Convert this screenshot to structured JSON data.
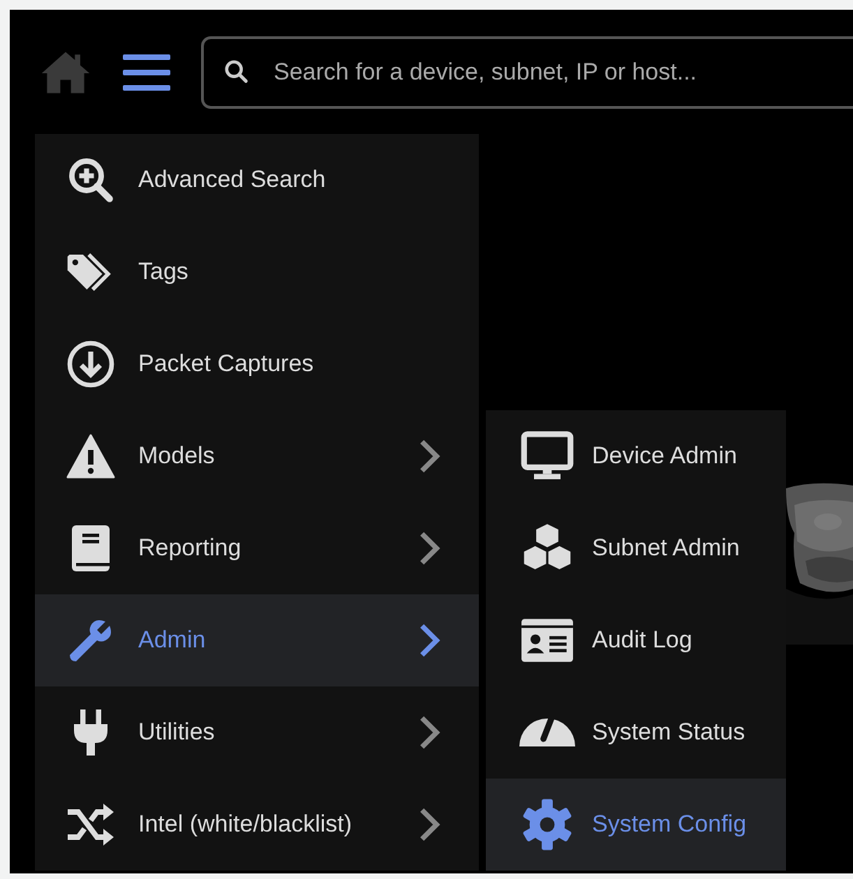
{
  "header": {
    "search": {
      "placeholder": "Search for a device, subnet, IP or host..."
    },
    "menu_button": {
      "active": true
    }
  },
  "menu": {
    "items": [
      {
        "label": "Advanced Search",
        "has_submenu": false,
        "selected": false
      },
      {
        "label": "Tags",
        "has_submenu": false,
        "selected": false
      },
      {
        "label": "Packet Captures",
        "has_submenu": false,
        "selected": false
      },
      {
        "label": "Models",
        "has_submenu": true,
        "selected": false
      },
      {
        "label": "Reporting",
        "has_submenu": true,
        "selected": false
      },
      {
        "label": "Admin",
        "has_submenu": true,
        "selected": true
      },
      {
        "label": "Utilities",
        "has_submenu": true,
        "selected": false
      },
      {
        "label": "Intel (white/blacklist)",
        "has_submenu": true,
        "selected": false
      }
    ]
  },
  "submenu": {
    "items": [
      {
        "label": "Device Admin",
        "selected": false
      },
      {
        "label": "Subnet Admin",
        "selected": false
      },
      {
        "label": "Audit Log",
        "selected": false
      },
      {
        "label": "System Status",
        "selected": false
      },
      {
        "label": "System Config",
        "selected": true
      }
    ]
  }
}
